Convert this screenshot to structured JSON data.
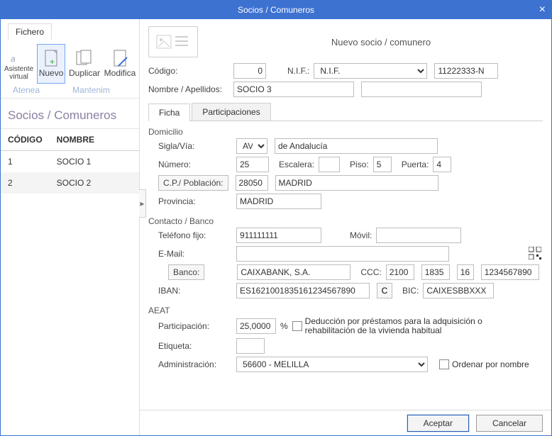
{
  "title": "Socios / Comuneros",
  "ribbon": {
    "file_tab": "Fichero",
    "buttons": {
      "asistente": "Asistente\nvirtual",
      "nuevo": "Nuevo",
      "duplicar": "Duplicar",
      "modificar": "Modifica"
    },
    "group_a": "Atenea",
    "group_b": "Mantenim"
  },
  "left_title": "Socios / Comuneros",
  "list": {
    "col_code": "CÓDIGO",
    "col_name": "NOMBRE",
    "rows": [
      {
        "code": "1",
        "name": "SOCIO 1"
      },
      {
        "code": "2",
        "name": "SOCIO 2"
      }
    ]
  },
  "form_header": "Nuevo socio / comunero",
  "labels": {
    "codigo": "Código:",
    "nif": "N.I.F.:",
    "nombre": "Nombre / Apellidos:",
    "domicilio": "Domicilio",
    "sigla": "Sigla/Vía:",
    "numero": "Número:",
    "escalera": "Escalera:",
    "piso": "Piso:",
    "puerta": "Puerta:",
    "cp": "C.P./ Población:",
    "provincia": "Provincia:",
    "contacto": "Contacto / Banco",
    "telefono": "Teléfono fijo:",
    "movil": "Móvil:",
    "email": "E-Mail:",
    "banco": "Banco:",
    "ccc": "CCC:",
    "iban": "IBAN:",
    "bic": "BIC:",
    "aeat": "AEAT",
    "participacion": "Participación:",
    "pct": "%",
    "deduccion": "Deducción por préstamos para la adquisición o rehabilitación de la vivienda habitual",
    "etiqueta": "Etiqueta:",
    "administracion": "Administración:",
    "ordenar": "Ordenar por nombre"
  },
  "tabs": {
    "ficha": "Ficha",
    "participaciones": "Participaciones"
  },
  "values": {
    "codigo": "0",
    "nif_type": "N.I.F.",
    "nif": "11222333-N",
    "nombre": "SOCIO 3",
    "apellidos": "",
    "sigla": "AV",
    "via": "de Andalucía",
    "numero": "25",
    "escalera": "",
    "piso": "5",
    "puerta": "4",
    "cp": "28050",
    "poblacion": "MADRID",
    "provincia": "MADRID",
    "telefono": "911111111",
    "movil": "",
    "email": "",
    "banco_nombre": "CAIXABANK, S.A.",
    "ccc1": "2100",
    "ccc2": "1835",
    "ccc3": "16",
    "ccc4": "1234567890",
    "iban": "ES1621001835161234567890",
    "iban_c": "C",
    "bic": "CAIXESBBXXX",
    "participacion": "25,0000",
    "etiqueta": "",
    "administracion": "56600 - MELILLA"
  },
  "footer": {
    "aceptar": "Aceptar",
    "cancelar": "Cancelar"
  }
}
